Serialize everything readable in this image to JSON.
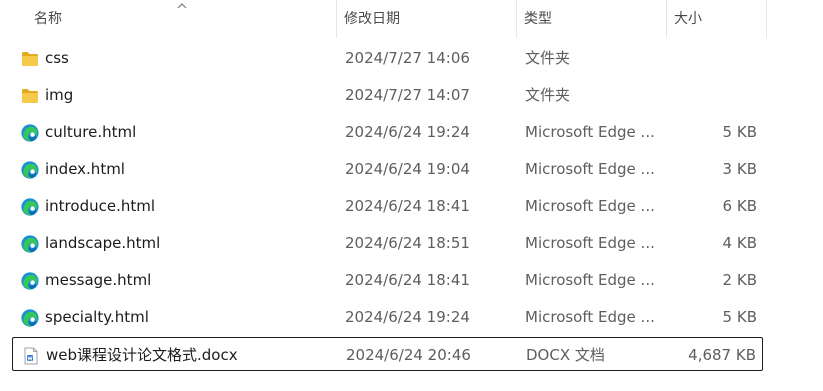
{
  "header": {
    "name": "名称",
    "date": "修改日期",
    "type": "类型",
    "size": "大小"
  },
  "colors": {
    "folder": "#f7c948",
    "edge": "#1a8fd6",
    "edge_green": "#34c759",
    "docx": "#2b78d6"
  },
  "files": [
    {
      "icon": "folder-icon",
      "name": "css",
      "date": "2024/7/27 14:06",
      "type": "文件夹",
      "size": ""
    },
    {
      "icon": "folder-icon",
      "name": "img",
      "date": "2024/7/27 14:07",
      "type": "文件夹",
      "size": ""
    },
    {
      "icon": "edge-icon",
      "name": "culture.html",
      "date": "2024/6/24 19:24",
      "type": "Microsoft Edge ...",
      "size": "5 KB"
    },
    {
      "icon": "edge-icon",
      "name": "index.html",
      "date": "2024/6/24 19:04",
      "type": "Microsoft Edge ...",
      "size": "3 KB"
    },
    {
      "icon": "edge-icon",
      "name": "introduce.html",
      "date": "2024/6/24 18:41",
      "type": "Microsoft Edge ...",
      "size": "6 KB"
    },
    {
      "icon": "edge-icon",
      "name": "landscape.html",
      "date": "2024/6/24 18:51",
      "type": "Microsoft Edge ...",
      "size": "4 KB"
    },
    {
      "icon": "edge-icon",
      "name": "message.html",
      "date": "2024/6/24 18:41",
      "type": "Microsoft Edge ...",
      "size": "2 KB"
    },
    {
      "icon": "edge-icon",
      "name": "specialty.html",
      "date": "2024/6/24 19:24",
      "type": "Microsoft Edge ...",
      "size": "5 KB"
    },
    {
      "icon": "docx-icon",
      "name": "web课程设计论文格式.docx",
      "date": "2024/6/24 20:46",
      "type": "DOCX 文档",
      "size": "4,687 KB"
    }
  ]
}
